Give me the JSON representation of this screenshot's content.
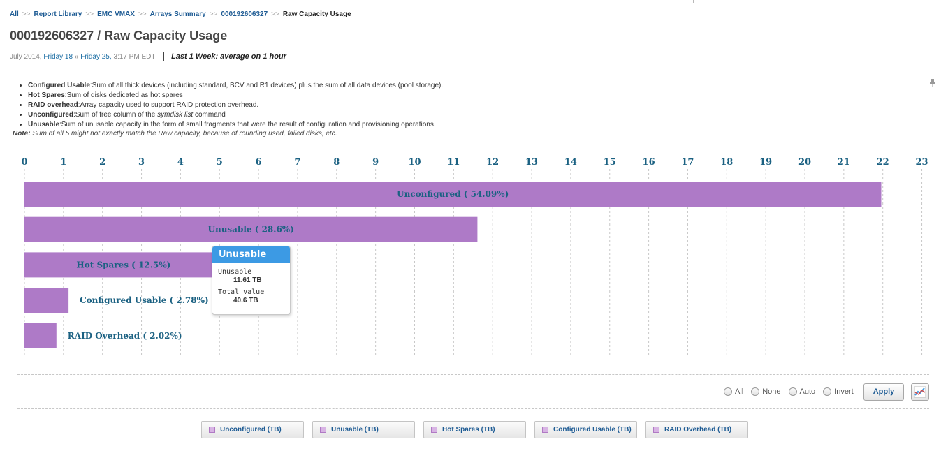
{
  "breadcrumb": {
    "items": [
      "All",
      "Report Library",
      "EMC VMAX",
      "Arrays Summary",
      "000192606327"
    ],
    "separator": ">>",
    "current": "Raw Capacity Usage"
  },
  "title": "000192606327 / Raw Capacity Usage",
  "date_range": {
    "prefix": "July 2014,",
    "start": "Friday 18",
    "arrow": "»",
    "end": "Friday 25,",
    "time": "3:17 PM EDT",
    "period": "Last 1 Week: average on 1 hour"
  },
  "descriptions": [
    {
      "term": "Configured Usable",
      "text": ":Sum of all thick devices (including standard, BCV and R1 devices) plus the sum of all data devices (pool storage)."
    },
    {
      "term": "Hot Spares",
      "text": ":Sum of disks dedicated as hot spares"
    },
    {
      "term": "RAID overhead",
      "text": ":Array capacity used to support RAID protection overhead."
    },
    {
      "term": "Unconfigured",
      "text": ":Sum of free column of the ",
      "em": "symdisk list",
      "tail": " command"
    },
    {
      "term": "Unusable",
      "text": ":Sum of unusable capacity in the form of small fragments that were the result of configuration and provisioning operations."
    }
  ],
  "note": {
    "label": "Note:",
    "text": " Sum of all 5 might not exactly match the Raw capacity, because of rounding used, failed disks, etc."
  },
  "chart_data": {
    "type": "bar",
    "orientation": "horizontal",
    "xlim": [
      0,
      23
    ],
    "x_ticks": [
      "0",
      "1",
      "2",
      "3",
      "4",
      "5",
      "6",
      "7",
      "8",
      "9",
      "10",
      "11",
      "12",
      "13",
      "14",
      "15",
      "16",
      "17",
      "18",
      "19",
      "20",
      "21",
      "22",
      "23"
    ],
    "grid": true,
    "bar_color": "#ae7ac7",
    "label_color": "#1b6182",
    "categories": [
      "Unconfigured",
      "Unusable",
      "Hot Spares",
      "Configured Usable",
      "RAID Overhead"
    ],
    "values": [
      21.96,
      11.61,
      5.08,
      1.13,
      0.82
    ],
    "labels": [
      "Unconfigured ( 54.09%)",
      "Unusable ( 28.6%)",
      "Hot Spares ( 12.5%)",
      "Configured Usable ( 2.78%)",
      "RAID Overhead ( 2.02%)"
    ]
  },
  "tooltip": {
    "title": "Unusable",
    "series_label": "Unusable",
    "series_value": "11.61 TB",
    "total_label": "Total value",
    "total_value": "40.6 TB"
  },
  "controls": {
    "radios": [
      "All",
      "None",
      "Auto",
      "Invert"
    ],
    "apply_label": "Apply"
  },
  "legend": [
    "Unconfigured (TB)",
    "Unusable (TB)",
    "Hot Spares (TB)",
    "Configured Usable (TB)",
    "RAID Overhead (TB)"
  ],
  "colors": {
    "accent": "#3c9ae4",
    "link": "#1c5a93",
    "bar": "#ae7ac7",
    "legend_swatch": "#d8b4e4"
  }
}
